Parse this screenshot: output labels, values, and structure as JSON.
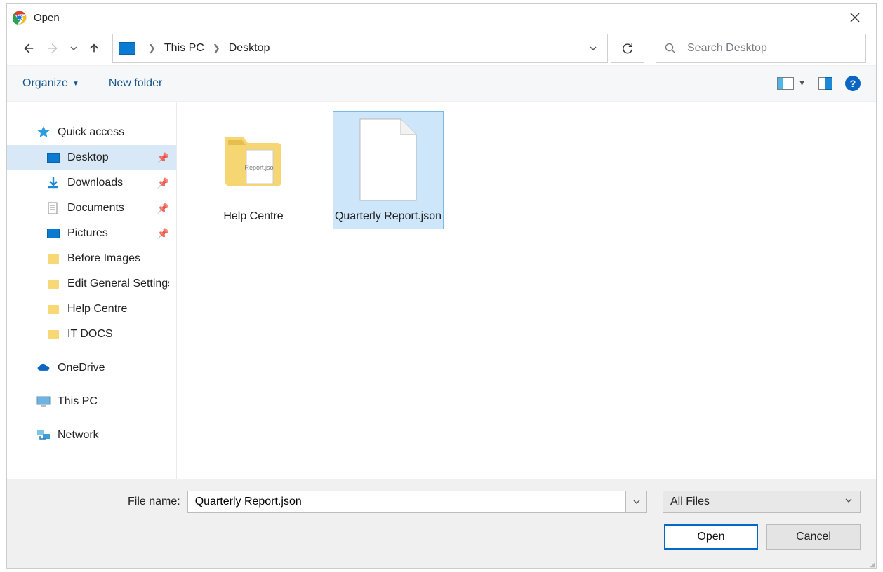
{
  "titlebar": {
    "title": "Open"
  },
  "breadcrumb": {
    "seg1": "This PC",
    "seg2": "Desktop"
  },
  "search": {
    "placeholder": "Search Desktop"
  },
  "toolbar": {
    "organize": "Organize",
    "new_folder": "New folder",
    "help": "?"
  },
  "sidebar": {
    "quick_access": "Quick access",
    "desktop": "Desktop",
    "downloads": "Downloads",
    "documents": "Documents",
    "pictures": "Pictures",
    "before_images": "Before Images",
    "edit_general": "Edit General Settings",
    "help_centre": "Help Centre",
    "it_docs": "IT DOCS",
    "onedrive": "OneDrive",
    "this_pc": "This PC",
    "network": "Network"
  },
  "content": {
    "folder1": "Help Centre",
    "file1": "Quarterly Report.json"
  },
  "footer": {
    "filename_label": "File name:",
    "filename_value": "Quarterly Report.json",
    "filter": "All Files",
    "open": "Open",
    "cancel": "Cancel"
  }
}
